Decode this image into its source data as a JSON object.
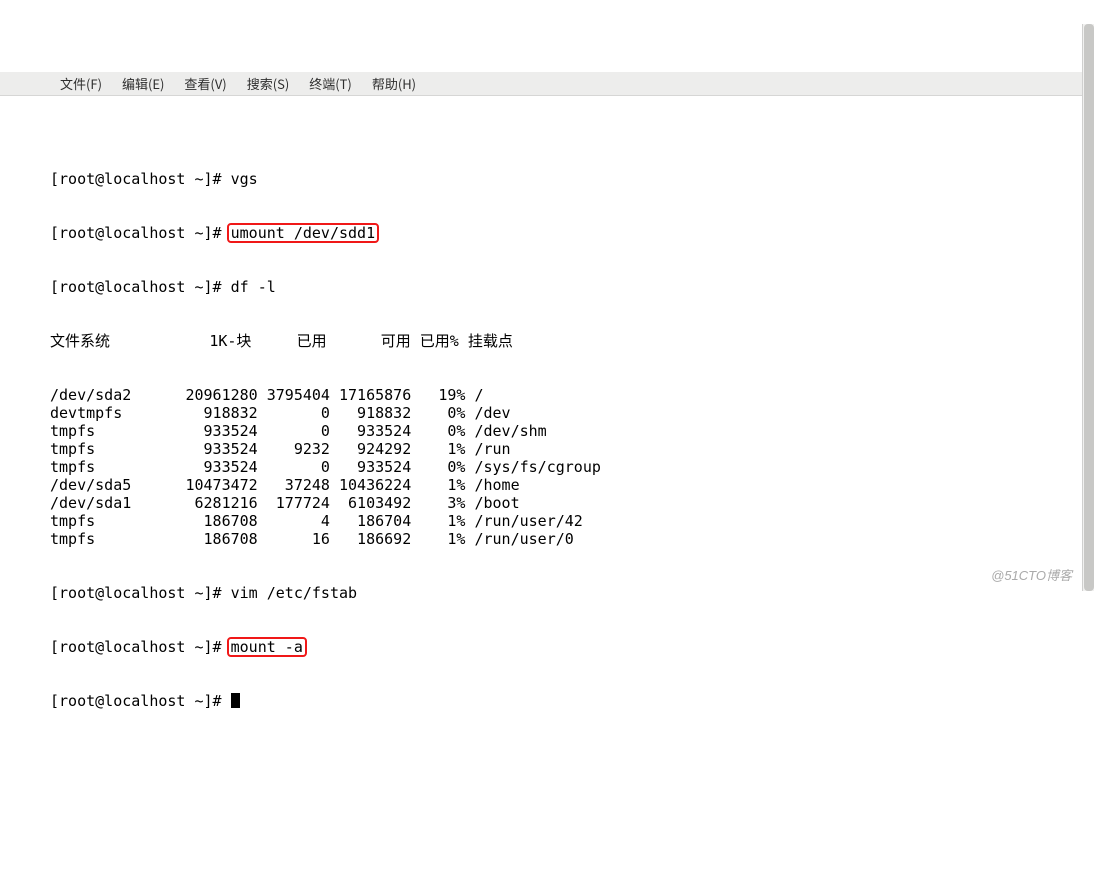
{
  "menu": {
    "file": "文件(F)",
    "edit": "编辑(E)",
    "view": "查看(V)",
    "search": "搜索(S)",
    "terminal": "终端(T)",
    "help": "帮助(H)"
  },
  "prompt": "[root@localhost ~]# ",
  "commands": {
    "vgs": "vgs",
    "umount": "umount /dev/sdd1",
    "dfl": "df -l",
    "vim": "vim /etc/fstab",
    "mount": "mount -a",
    "blank": ""
  },
  "df": {
    "header": "文件系统           1K-块     已用      可用 已用% 挂载点",
    "rows": [
      {
        "fs": "/dev/sda2",
        "blocks": "20961280",
        "used": "3795404",
        "avail": "17165876",
        "usep": "19%",
        "mount": "/"
      },
      {
        "fs": "devtmpfs",
        "blocks": "918832",
        "used": "0",
        "avail": "918832",
        "usep": "0%",
        "mount": "/dev"
      },
      {
        "fs": "tmpfs",
        "blocks": "933524",
        "used": "0",
        "avail": "933524",
        "usep": "0%",
        "mount": "/dev/shm"
      },
      {
        "fs": "tmpfs",
        "blocks": "933524",
        "used": "9232",
        "avail": "924292",
        "usep": "1%",
        "mount": "/run"
      },
      {
        "fs": "tmpfs",
        "blocks": "933524",
        "used": "0",
        "avail": "933524",
        "usep": "0%",
        "mount": "/sys/fs/cgroup"
      },
      {
        "fs": "/dev/sda5",
        "blocks": "10473472",
        "used": "37248",
        "avail": "10436224",
        "usep": "1%",
        "mount": "/home"
      },
      {
        "fs": "/dev/sda1",
        "blocks": "6281216",
        "used": "177724",
        "avail": "6103492",
        "usep": "3%",
        "mount": "/boot"
      },
      {
        "fs": "tmpfs",
        "blocks": "186708",
        "used": "4",
        "avail": "186704",
        "usep": "1%",
        "mount": "/run/user/42"
      },
      {
        "fs": "tmpfs",
        "blocks": "186708",
        "used": "16",
        "avail": "186692",
        "usep": "1%",
        "mount": "/run/user/0"
      }
    ]
  },
  "watermark": "@51CTO博客"
}
